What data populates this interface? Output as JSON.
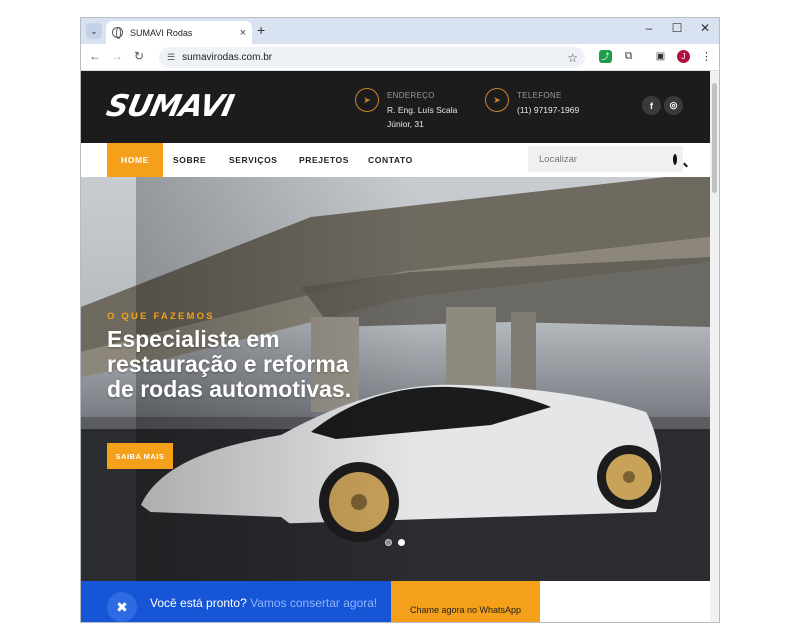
{
  "browser": {
    "tab_title": "SUMAVI Rodas",
    "tab_close": "×",
    "new_tab": "+",
    "url": "sumavirodas.com.br",
    "profile_initial": "J",
    "window_controls": {
      "minimize": "–",
      "maximize": "☐",
      "close": "✕"
    }
  },
  "header": {
    "logo": "SUMAVI",
    "address_label": "ENDEREÇO",
    "address_line1": "R. Eng. Luís Scala",
    "address_line2": "Júnior, 31",
    "phone_label": "TELEFONE",
    "phone_value": "(11) 97197-1969",
    "social": {
      "facebook": "f",
      "instagram": "◎"
    }
  },
  "nav": {
    "items": [
      "HOME",
      "SOBRE",
      "SERVIÇOS",
      "PREJETOS",
      "CONTATO"
    ],
    "search_placeholder": "Localizar"
  },
  "hero": {
    "eyebrow": "O QUE FAZEMOS",
    "title": "Especialista em restauração e reforma de rodas automotivas.",
    "button": "SAIBA MAIS",
    "slides": 2,
    "active_slide": 2
  },
  "cta": {
    "text_main": "Você está pronto?",
    "text_highlight": "Vamos consertar agora!",
    "button": "Chame agora no WhatsApp"
  },
  "colors": {
    "accent": "#f5a01a",
    "header_bg": "#1c1c1c",
    "cta_blue": "#1656d6"
  }
}
